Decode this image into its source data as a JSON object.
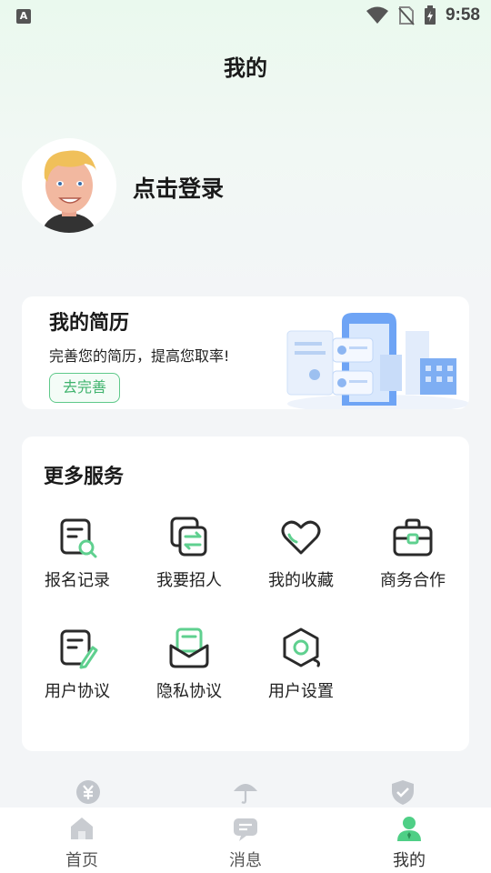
{
  "status_bar": {
    "time": "9:58",
    "notification_icon": "A"
  },
  "header": {
    "title": "我的"
  },
  "profile": {
    "login_label": "点击登录"
  },
  "resume": {
    "title": "我的简历",
    "subtitle": "完善您的简历，提高您取率!",
    "button_label": "去完善"
  },
  "services": {
    "title": "更多服务",
    "items": [
      {
        "label": "报名记录",
        "icon": "document-search-icon"
      },
      {
        "label": "我要招人",
        "icon": "swap-recruit-icon"
      },
      {
        "label": "我的收藏",
        "icon": "heart-icon"
      },
      {
        "label": "商务合作",
        "icon": "briefcase-icon"
      },
      {
        "label": "用户协议",
        "icon": "document-edit-icon"
      },
      {
        "label": "隐私协议",
        "icon": "mail-icon"
      },
      {
        "label": "用户设置",
        "icon": "settings-hexagon-icon"
      }
    ]
  },
  "tabbar": {
    "tabs": [
      {
        "label": "首页",
        "icon": "home-icon"
      },
      {
        "label": "消息",
        "icon": "message-icon"
      },
      {
        "label": "我的",
        "icon": "user-icon",
        "active": true
      }
    ]
  },
  "colors": {
    "accent": "#3fb36d",
    "icon_green": "#5fd08f",
    "dark": "#2a2a2a"
  }
}
